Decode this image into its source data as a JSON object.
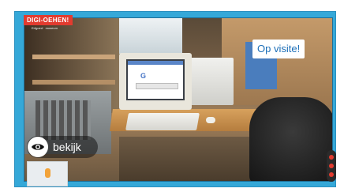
{
  "brand": {
    "name": "DIGI-OEHEN!",
    "subtitle": "Erfgoed · museum"
  },
  "scene": {
    "location_tag": "Op visite!",
    "view_button_label": "bekijk"
  },
  "colors": {
    "frame": "#35a8d8",
    "brand_red": "#e23b2f",
    "tag_text": "#1d6fb8",
    "view_button_bg": "rgba(20,20,20,0.55)"
  },
  "icons": {
    "view_icon": "eye-icon",
    "map_pin": "location-pin-icon",
    "nav_control": "navigation-control-icon"
  }
}
